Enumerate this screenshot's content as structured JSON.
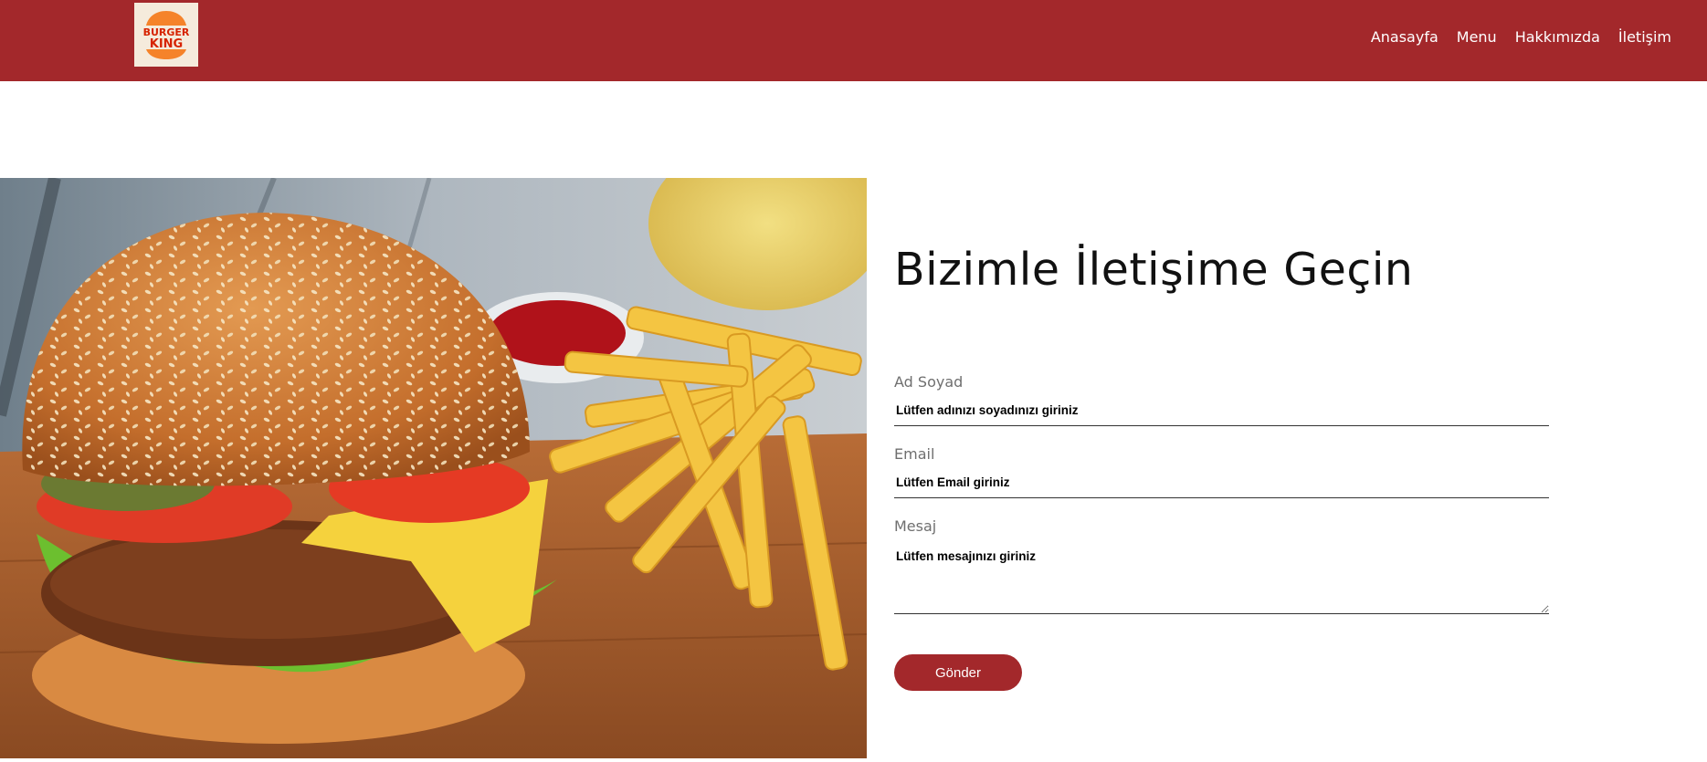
{
  "brand": {
    "logo_line1": "BURGER",
    "logo_line2": "KING",
    "header_color": "#a3282b"
  },
  "nav": {
    "items": [
      {
        "label": "Anasayfa"
      },
      {
        "label": "Menu"
      },
      {
        "label": "Hakkımızda"
      },
      {
        "label": "İletişim"
      }
    ]
  },
  "contact": {
    "title": "Bizimle İletişime Geçin",
    "fields": {
      "name": {
        "label": "Ad Soyad",
        "placeholder": "Lütfen adınızı soyadınızı giriniz"
      },
      "email": {
        "label": "Email",
        "placeholder": "Lütfen Email giriniz"
      },
      "message": {
        "label": "Mesaj",
        "placeholder": "Lütfen mesajınızı giriniz"
      }
    },
    "submit_label": "Gönder"
  },
  "icons": {
    "logo": "burger-king-logo",
    "hero": "burger-and-fries-photo"
  }
}
